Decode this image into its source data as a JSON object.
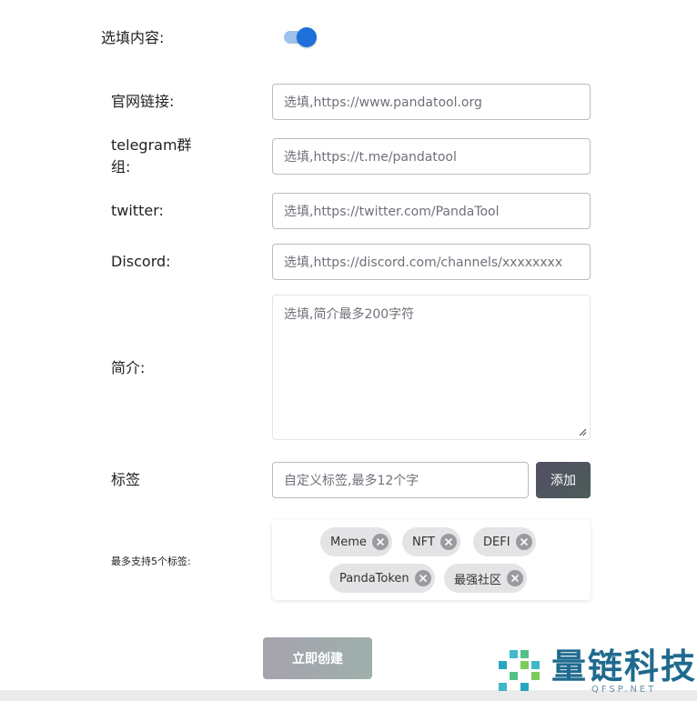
{
  "optional_section": {
    "label": "选填内容:",
    "enabled": true
  },
  "fields": {
    "website": {
      "label": "官网链接:",
      "placeholder": "选填,https://www.pandatool.org"
    },
    "telegram": {
      "label_line1": "telegram群",
      "label_line2": "组:",
      "placeholder": "选填,https://t.me/pandatool"
    },
    "twitter": {
      "label": "twitter:",
      "placeholder": "选填,https://twitter.com/PandaTool"
    },
    "discord": {
      "label": "Discord:",
      "placeholder": "选填,https://discord.com/channels/xxxxxxxx"
    },
    "intro": {
      "label": "简介:",
      "placeholder": "选填,简介最多200字符"
    }
  },
  "tags": {
    "label": "标签",
    "input_placeholder": "自定义标签,最多12个字",
    "add_label": "添加",
    "limit_label": "最多支持5个标签:",
    "items": [
      "Meme",
      "NFT",
      "DEFI",
      "PandaToken",
      "最强社区"
    ]
  },
  "submit": {
    "label": "立即创建"
  },
  "watermark": {
    "text": "量链科技",
    "sub": "QFSP.NET"
  },
  "colors": {
    "toggle_on": "#1e6fd9",
    "toggle_track": "#9ec2ee",
    "add_button": "#534f64",
    "chip_bg": "#e4e4e6",
    "watermark": "#1f6a8e"
  }
}
